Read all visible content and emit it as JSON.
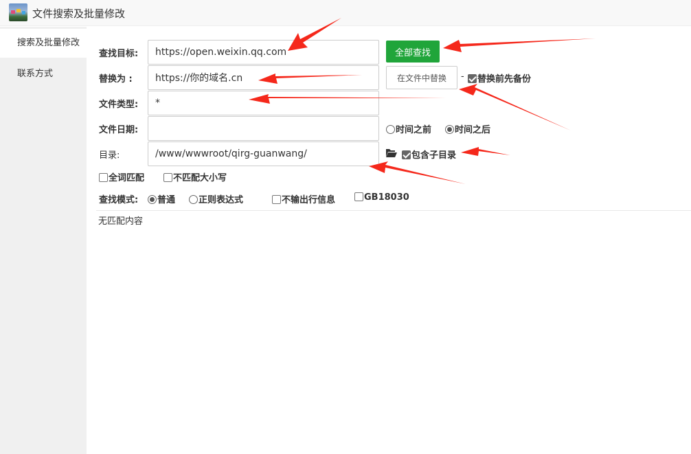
{
  "window": {
    "title": "文件搜索及批量修改",
    "icon": "app-thumbnail-icon"
  },
  "sidebar": {
    "items": [
      {
        "label": "搜索及批量修改",
        "active": true
      },
      {
        "label": "联系方式",
        "active": false
      }
    ]
  },
  "form": {
    "search_target": {
      "label": "查找目标:",
      "value": "https://open.weixin.qq.com"
    },
    "replace_with": {
      "label": "替换为 :",
      "value": "https://你的域名.cn"
    },
    "file_type": {
      "label": "文件类型:",
      "value": "*"
    },
    "file_date": {
      "label": "文件日期:",
      "value": ""
    },
    "directory": {
      "label": "目录:",
      "value": "/www/wwwroot/qirg-guanwang/"
    },
    "find_all_button": "全部查找",
    "replace_in_files_button": "在文件中替换",
    "dash": "-",
    "backup_first": {
      "label": "替换前先备份",
      "checked": true
    },
    "date_before": {
      "label": "时间之前",
      "checked": false
    },
    "date_after": {
      "label": "时间之后",
      "checked": true
    },
    "folder_icon": "folder-open-icon",
    "include_subdirs": {
      "label": "包含子目录",
      "checked": true
    },
    "whole_word": {
      "label": "全词匹配",
      "checked": false
    },
    "ignore_case": {
      "label": "不匹配大小写",
      "checked": false
    },
    "search_mode": {
      "label": "查找模式:",
      "normal": {
        "label": "普通",
        "checked": true
      },
      "regex": {
        "label": "正则表达式",
        "checked": false
      }
    },
    "no_line_output": {
      "label": "不输出行信息",
      "checked": false
    },
    "gb18030": {
      "label": "GB18030",
      "checked": false
    }
  },
  "result": {
    "text": "无匹配内容"
  },
  "colors": {
    "accent_green": "#20a53a",
    "annotation_red": "#f5281b",
    "sidebar_bg": "#f0f0f0"
  }
}
